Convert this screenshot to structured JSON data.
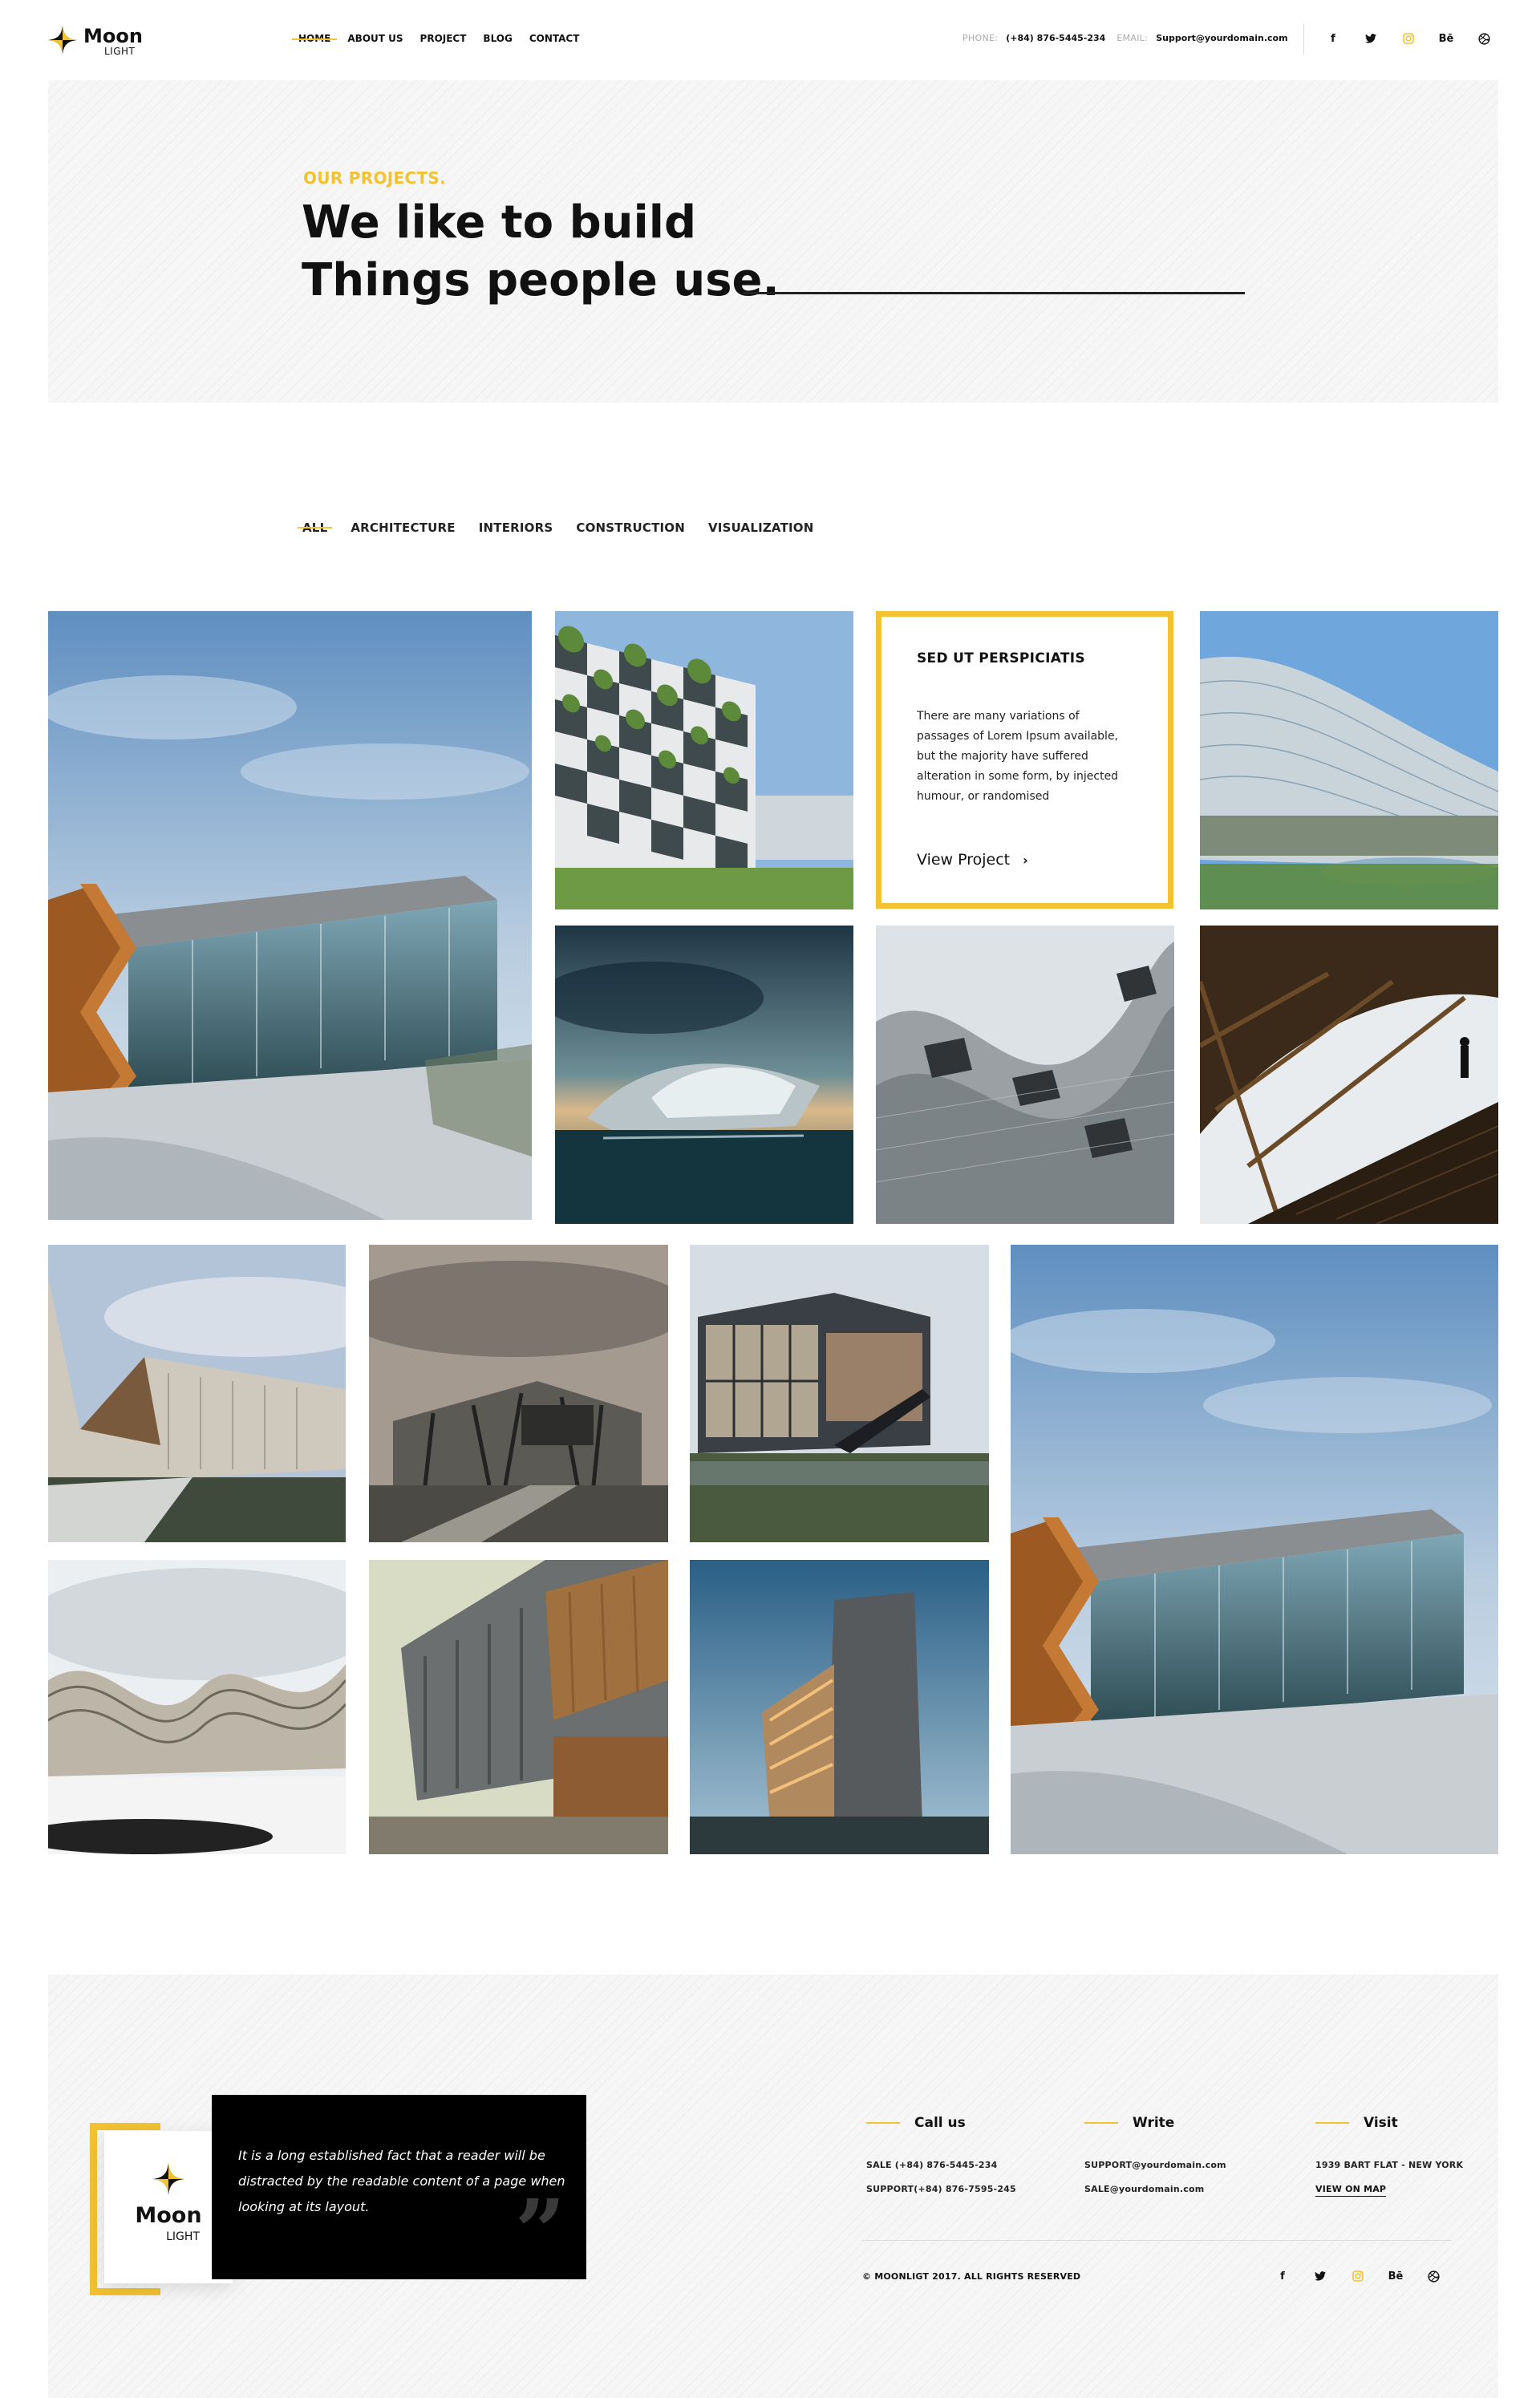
{
  "brand": {
    "name": "Moon",
    "sub": "LIGHT",
    "accent": "#f2c230"
  },
  "nav": [
    {
      "label": "HOME",
      "active": true
    },
    {
      "label": "ABOUT US"
    },
    {
      "label": "PROJECT"
    },
    {
      "label": "BLOG"
    },
    {
      "label": "CONTACT"
    }
  ],
  "contact_top": {
    "phone_label": "PHONE:",
    "phone": "(+84) 876-5445-234",
    "email_label": "EMAIL:",
    "email": "Support@yourdomain.com"
  },
  "social": [
    {
      "icon": "facebook-icon",
      "glyph": "f"
    },
    {
      "icon": "twitter-icon",
      "glyph": "🐦"
    },
    {
      "icon": "instagram-icon",
      "glyph": "◘"
    },
    {
      "icon": "behance-icon",
      "glyph": "Bē"
    },
    {
      "icon": "dribbble-icon",
      "glyph": "⊛"
    }
  ],
  "hero": {
    "kicker": "OUR PROJECTS.",
    "title_line1": "We like to build",
    "title_line2": "Things people use."
  },
  "filters": [
    "ALL",
    "ARCHITECTURE",
    "INTERIORS",
    "CONSTRUCTION",
    "VISUALIZATION"
  ],
  "active_filter": "ALL",
  "feature": {
    "title": "SED UT PERSPICIATIS",
    "text": "There are many variations of passages of Lorem Ipsum available, but the majority have suffered alteration in some form, by injected humour, or randomised",
    "link": "View Project",
    "link_icon": "chevron-right-icon"
  },
  "footer": {
    "brand": {
      "name": "Moon",
      "sub": "LIGHT"
    },
    "quote": "It is a long established fact that a reader will be distracted by the readable content of a page when looking at its layout.",
    "quote_mark": "”",
    "columns": {
      "call": {
        "title": "Call us",
        "lines": [
          "SALE (+84) 876-5445-234",
          "SUPPORT(+84) 876-7595-245"
        ]
      },
      "write": {
        "title": "Write",
        "lines": [
          "SUPPORT@yourdomain.com",
          "SALE@yourdomain.com"
        ]
      },
      "visit": {
        "title": "Visit",
        "lines": [
          "1939 BART FLAT - NEW YORK"
        ],
        "link": "VIEW ON MAP"
      }
    },
    "copyright": "© MOONLIGT 2017. ALL RIGHTS RESERVED"
  }
}
